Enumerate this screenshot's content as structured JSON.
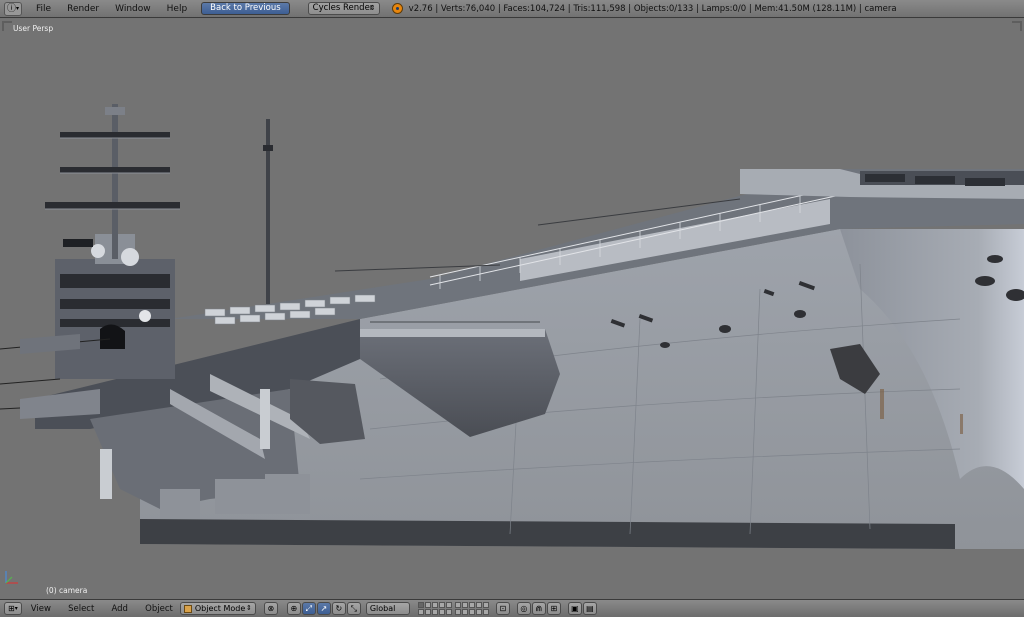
{
  "top_header": {
    "menus": [
      "File",
      "Render",
      "Window",
      "Help"
    ],
    "back_button": "Back to Previous",
    "render_engine": "Cycles Render",
    "stats": "v2.76 | Verts:76,040 | Faces:104,724 | Tris:111,598 | Objects:0/133 | Lamps:0/0 | Mem:41.50M (128.11M) | camera"
  },
  "viewport": {
    "view_label": "User Persp",
    "object_label": "(0) camera"
  },
  "bottom_header": {
    "menus": [
      "View",
      "Select",
      "Add",
      "Object"
    ],
    "mode": "Object Mode",
    "orientation": "Global"
  },
  "colors": {
    "viewport_bg": "#737373",
    "header_bg": "#7d7d7d",
    "active_button": "#4a6a9c"
  }
}
